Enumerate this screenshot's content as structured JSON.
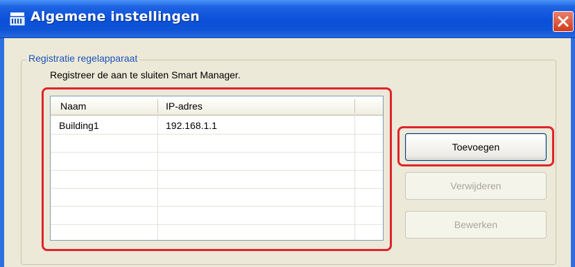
{
  "window": {
    "title": "Algemene instellingen",
    "title_icon": "settings-window-icon",
    "close_icon": "close-icon"
  },
  "group": {
    "legend": "Registratie regelapparaat",
    "instruction": "Registreer de aan te sluiten Smart Manager."
  },
  "table": {
    "columns": [
      "Naam",
      "IP-adres"
    ],
    "rows": [
      {
        "name": "Building1",
        "ip": "192.168.1.1"
      },
      {
        "name": "",
        "ip": ""
      },
      {
        "name": "",
        "ip": ""
      },
      {
        "name": "",
        "ip": ""
      },
      {
        "name": "",
        "ip": ""
      },
      {
        "name": "",
        "ip": ""
      },
      {
        "name": "",
        "ip": ""
      }
    ]
  },
  "buttons": {
    "add_label": "Toevoegen",
    "delete_label": "Verwijderen",
    "edit_label": "Bewerken"
  },
  "colors": {
    "titlebar": "#0a4fd8",
    "highlight": "#e0232b",
    "legend_text": "#1b53b8"
  }
}
